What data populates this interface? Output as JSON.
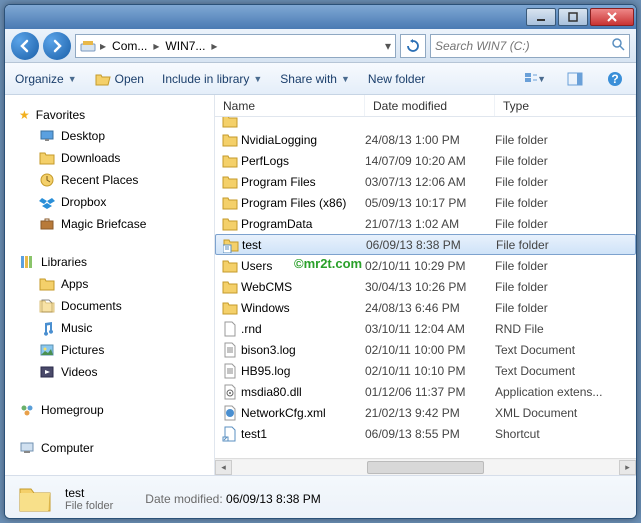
{
  "search": {
    "placeholder": "Search WIN7 (C:)"
  },
  "breadcrumb": {
    "item1": "Com...",
    "item2": "WIN7..."
  },
  "toolbar": {
    "organize": "Organize",
    "open": "Open",
    "include": "Include in library",
    "share": "Share with",
    "newfolder": "New folder"
  },
  "nav": {
    "favorites": "Favorites",
    "desktop": "Desktop",
    "downloads": "Downloads",
    "recent": "Recent Places",
    "dropbox": "Dropbox",
    "briefcase": "Magic Briefcase",
    "libraries": "Libraries",
    "apps": "Apps",
    "documents": "Documents",
    "music": "Music",
    "pictures": "Pictures",
    "videos": "Videos",
    "homegroup": "Homegroup",
    "computer": "Computer"
  },
  "columns": {
    "name": "Name",
    "date": "Date modified",
    "type": "Type"
  },
  "rows": [
    {
      "name": "",
      "date": "",
      "type": "",
      "icon": "folder",
      "cut": true
    },
    {
      "name": "NvidiaLogging",
      "date": "24/08/13 1:00 PM",
      "type": "File folder",
      "icon": "folder"
    },
    {
      "name": "PerfLogs",
      "date": "14/07/09 10:20 AM",
      "type": "File folder",
      "icon": "folder"
    },
    {
      "name": "Program Files",
      "date": "03/07/13 12:06 AM",
      "type": "File folder",
      "icon": "folder"
    },
    {
      "name": "Program Files (x86)",
      "date": "05/09/13 10:17 PM",
      "type": "File folder",
      "icon": "folder"
    },
    {
      "name": "ProgramData",
      "date": "21/07/13 1:02 AM",
      "type": "File folder",
      "icon": "folder"
    },
    {
      "name": "test",
      "date": "06/09/13 8:38 PM",
      "type": "File folder",
      "icon": "test",
      "selected": true
    },
    {
      "name": "Users",
      "date": "02/10/11 10:29 PM",
      "type": "File folder",
      "icon": "folder"
    },
    {
      "name": "WebCMS",
      "date": "30/04/13 10:26 PM",
      "type": "File folder",
      "icon": "folder"
    },
    {
      "name": "Windows",
      "date": "24/08/13 6:46 PM",
      "type": "File folder",
      "icon": "folder"
    },
    {
      "name": ".rnd",
      "date": "03/10/11 12:04 AM",
      "type": "RND File",
      "icon": "file"
    },
    {
      "name": "bison3.log",
      "date": "02/10/11 10:00 PM",
      "type": "Text Document",
      "icon": "text"
    },
    {
      "name": "HB95.log",
      "date": "02/10/11 10:10 PM",
      "type": "Text Document",
      "icon": "text"
    },
    {
      "name": "msdia80.dll",
      "date": "01/12/06 11:37 PM",
      "type": "Application extens...",
      "icon": "dll"
    },
    {
      "name": "NetworkCfg.xml",
      "date": "21/02/13 9:42 PM",
      "type": "XML Document",
      "icon": "xml"
    },
    {
      "name": "test1",
      "date": "06/09/13 8:55 PM",
      "type": "Shortcut",
      "icon": "shortcut"
    }
  ],
  "details": {
    "name": "test",
    "type": "File folder",
    "datemod_label": "Date modified:",
    "datemod_value": "06/09/13 8:38 PM"
  },
  "watermark": "©mr2t.com"
}
